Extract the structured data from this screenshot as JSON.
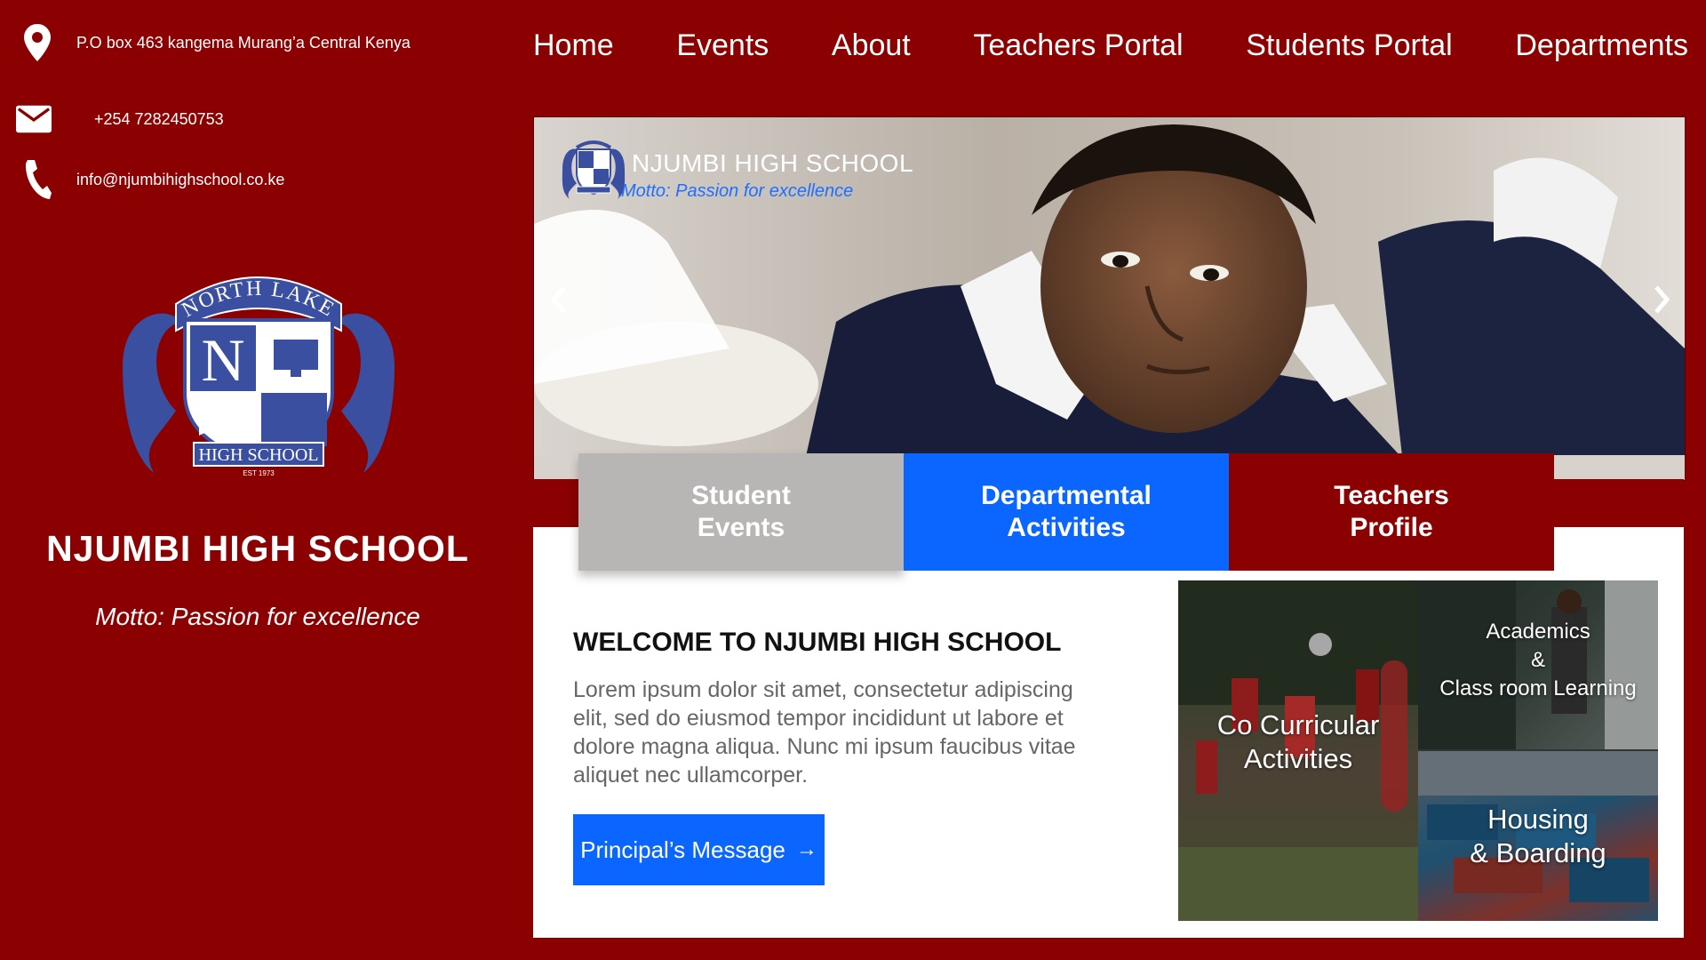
{
  "contact": {
    "address": "P.O box 463 kangema Murang’a Central Kenya",
    "phone": "+254 7282450753",
    "email": "info@njumbihighschool.co.ke"
  },
  "crest": {
    "arc_text": "NORTH LAKE",
    "banner_text": "HIGH SCHOOL",
    "est": "EST 1973",
    "letter_n": "N",
    "letter_l": "L"
  },
  "sidebar": {
    "school_name": "NJUMBI HIGH SCHOOL",
    "motto": "Motto: Passion for excellence"
  },
  "nav": {
    "items": [
      "Home",
      "Events",
      "About",
      "Teachers Portal",
      "Students Portal",
      "Departments"
    ]
  },
  "hero": {
    "title": "NJUMBI HIGH SCHOOL",
    "motto": "Motto: Passion for excellence"
  },
  "tabs": [
    {
      "line1": "Student",
      "line2": "Events"
    },
    {
      "line1": "Departmental",
      "line2": "Activities"
    },
    {
      "line1": "Teachers",
      "line2": "Profile"
    }
  ],
  "welcome": {
    "title": "WELCOME TO NJUMBI HIGH SCHOOL",
    "body": "Lorem ipsum dolor sit amet, consectetur adipiscing elit, sed do eiusmod tempor incididunt ut labore et dolore magna aliqua. Nunc mi ipsum faucibus vitae aliquet nec ullamcorper.",
    "button_label": "Principal’s Message",
    "button_arrow": "→"
  },
  "gallery": {
    "cocurricular": {
      "line1": "Co Curricular",
      "line2": "Activities"
    },
    "academics": {
      "line1": "Academics",
      "line2": "&",
      "line3": "Class room Learning"
    },
    "housing": {
      "line1": "Housing",
      "line2": "& Boarding"
    }
  },
  "colors": {
    "brand_red": "#8b0000",
    "accent_blue": "#0b66ff",
    "tab_grey": "#b8b5b5",
    "crest_blue": "#3a4fa0"
  }
}
